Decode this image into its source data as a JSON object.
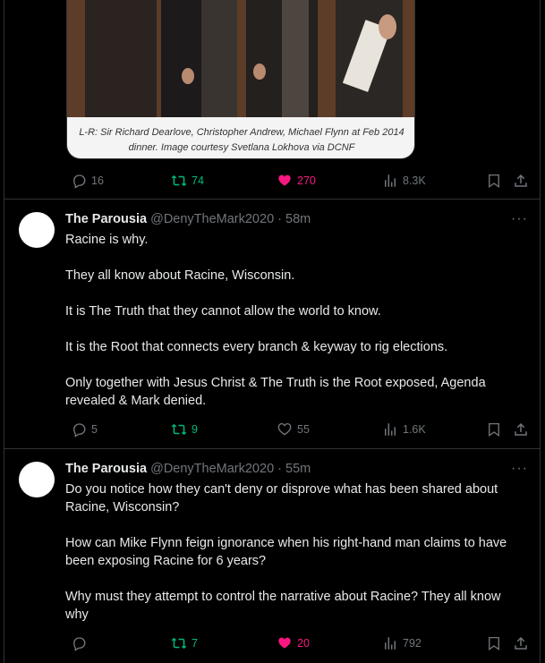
{
  "top_tweet": {
    "caption": "L-R: Sir Richard Dearlove, Christopher Andrew, Michael Flynn at Feb 2014 dinner. Image courtesy Svetlana Lokhova via DCNF",
    "replies": "16",
    "retweets": "74",
    "likes": "270",
    "views": "8.3K",
    "likes_active": true
  },
  "tweets": [
    {
      "name": "The Parousia",
      "handle": "@DenyTheMark2020",
      "dot": "·",
      "time": "58m",
      "paragraphs": [
        "Racine is why.",
        "They all know about Racine, Wisconsin.",
        "It is The Truth that they cannot allow the world to know.",
        "It is the Root that connects every branch & keyway to rig elections.",
        "Only together with Jesus Christ & The Truth is the Root exposed, Agenda revealed & Mark denied."
      ],
      "replies": "5",
      "retweets": "9",
      "likes": "55",
      "views": "1.6K"
    },
    {
      "name": "The Parousia",
      "handle": "@DenyTheMark2020",
      "dot": "·",
      "time": "55m",
      "paragraphs": [
        "Do you notice how they can't deny or disprove what has been shared about Racine, Wisconsin?",
        "How can Mike Flynn feign ignorance when his right-hand man claims to have been exposing Racine for 6 years?",
        "Why must they attempt to control the narrative about Racine? They all know why"
      ],
      "replies": "",
      "retweets": "7",
      "likes": "20",
      "views": "792"
    }
  ],
  "colors": {
    "background": "#000000",
    "text": "#e7e9ea",
    "muted": "#71767b",
    "retweet_green": "#00ba7c",
    "like_pink": "#f91880",
    "divider": "#2f3336"
  },
  "icons": [
    "reply-icon",
    "retweet-icon",
    "like-icon",
    "views-icon",
    "bookmark-icon",
    "share-icon",
    "more-icon"
  ]
}
